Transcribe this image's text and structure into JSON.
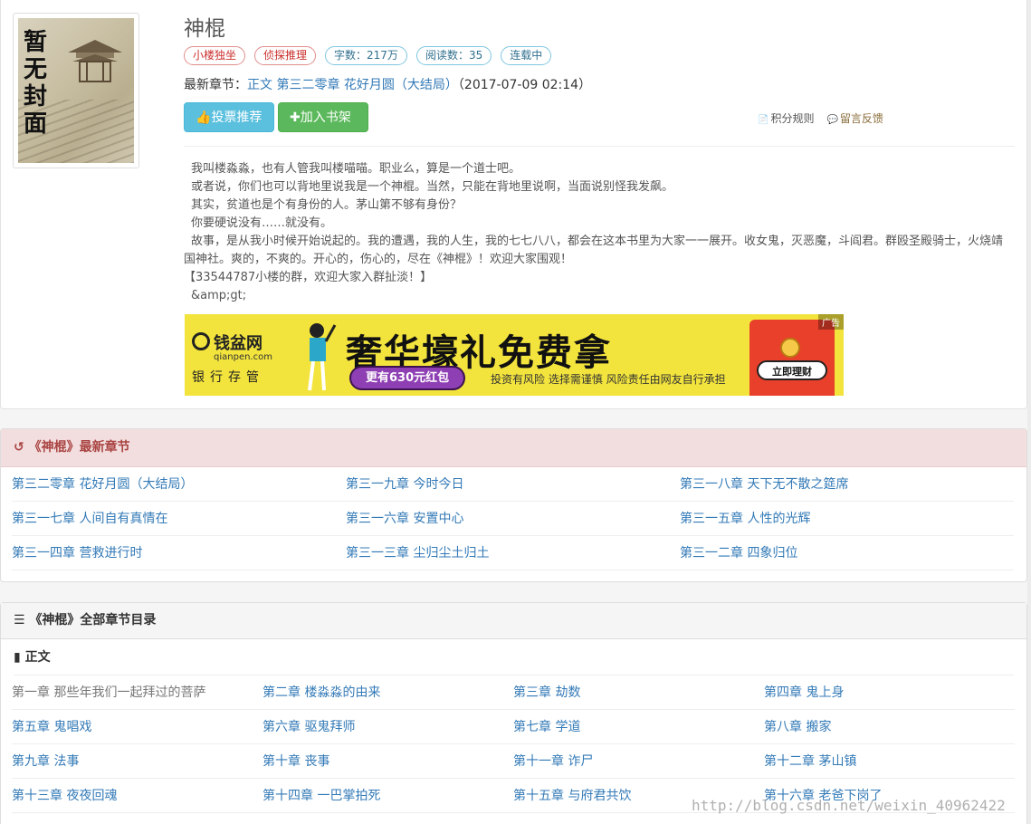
{
  "book": {
    "title": "神棍",
    "cover_text": "暂无封面",
    "tags": [
      "小楼独坐",
      "侦探推理",
      "字数：217万",
      "阅读数：35",
      "连载中"
    ],
    "latest_label": "最新章节：",
    "latest_chapter": "正文 第三二零章 花好月圆（大结局）",
    "latest_time": "（2017-07-09 02:14）",
    "vote_label": "投票推荐",
    "shelf_label": "加入书架",
    "points_rules": "积分规则",
    "feedback": "留言反馈",
    "intro": [
      "我叫楼淼淼，也有人管我叫楼喵喵。职业么，算是一个道士吧。",
      "或者说，你们也可以背地里说我是一个神棍。当然，只能在背地里说啊，当面说别怪我发飙。",
      "其实，贫道也是个有身份的人。茅山第不够有身份？",
      "你要硬说没有……就没有。",
      "故事，是从我小时候开始说起的。我的遭遇，我的人生，我的七七八八，都会在这本书里为大家一一展开。收女鬼，灭恶魔，斗阎君。群殴圣殿骑士，火烧靖国神社。爽的，不爽的。开心的，伤心的，尽在《神棍》！欢迎大家围观！",
      "【33544787小楼的群，欢迎大家入群扯淡！】",
      "&amp;gt;"
    ]
  },
  "ad": {
    "brand": "钱盆网",
    "domain": "qianpen.com",
    "sub": "银行存管",
    "headline": "奢华壕礼免费拿",
    "pill": "更有630元红包",
    "note": "投资有风险 选择需谨慎 风险责任由网友自行承担",
    "cta": "立即理财",
    "badge": "广告"
  },
  "latest_panel": {
    "title": "《神棍》最新章节",
    "chapters": [
      "第三二零章 花好月圆（大结局）",
      "第三一九章 今时今日",
      "第三一八章 天下无不散之筵席",
      "第三一七章 人间自有真情在",
      "第三一六章 安置中心",
      "第三一五章 人性的光辉",
      "第三一四章 营救进行时",
      "第三一三章 尘归尘土归土",
      "第三一二章 四象归位"
    ]
  },
  "all_panel": {
    "title": "《神棍》全部章节目录",
    "volume": "正文",
    "chapters": [
      "第一章 那些年我们一起拜过的菩萨",
      "第二章 楼淼淼的由来",
      "第三章 劫数",
      "第四章 鬼上身",
      "第五章 鬼唱戏",
      "第六章 驱鬼拜师",
      "第七章 学道",
      "第八章 搬家",
      "第九章 法事",
      "第十章 丧事",
      "第十一章 诈尸",
      "第十二章 茅山镇",
      "第十三章 夜夜回魂",
      "第十四章 一巴掌拍死",
      "第十五章 与府君共饮",
      "第十六章 老爸下岗了"
    ]
  },
  "watermark": "http://blog.csdn.net/weixin_40962422"
}
